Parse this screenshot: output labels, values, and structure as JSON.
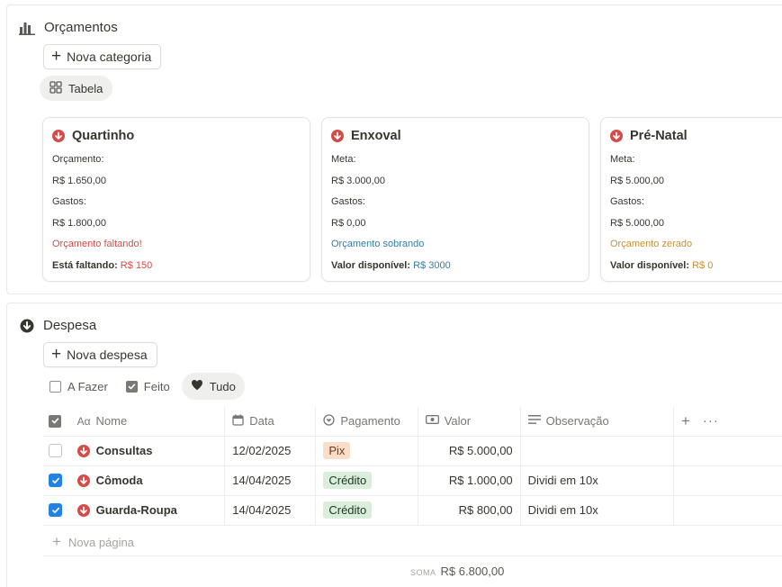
{
  "orcamentos": {
    "title": "Orçamentos",
    "new_button": "Nova categoria",
    "view_tab": "Tabela",
    "cards": [
      {
        "title": "Quartinho",
        "l1": "Orçamento:",
        "l2": "R$ 1.650,00",
        "l3": "Gastos:",
        "l4": "R$ 1.800,00",
        "status": "Orçamento faltando!",
        "foot_label": "Está faltando:",
        "foot_value": "R$ 150"
      },
      {
        "title": "Enxoval",
        "l1": "Meta:",
        "l2": "R$ 3.000,00",
        "l3": "Gastos:",
        "l4": "R$ 0,00",
        "status": "Orçamento sobrando",
        "foot_label": "Valor disponível:",
        "foot_value": "R$ 3000"
      },
      {
        "title": "Pré-Natal",
        "l1": "Meta:",
        "l2": "R$ 5.000,00",
        "l3": "Gastos:",
        "l4": "R$ 5.000,00",
        "status": "Orçamento zerado",
        "foot_label": "Valor disponível:",
        "foot_value": "R$ 0"
      }
    ],
    "status_colors": {
      "faltando": "#d44c47",
      "sobrando": "#337ea9",
      "zerado": "#cb912f"
    }
  },
  "despesa": {
    "title": "Despesa",
    "new_button": "Nova despesa",
    "filters": [
      "A Fazer",
      "Feito",
      "Tudo"
    ],
    "columns": {
      "name": "Nome",
      "date": "Data",
      "payment": "Pagamento",
      "value": "Valor",
      "note": "Observação"
    },
    "rows": [
      {
        "checked": false,
        "name": "Consultas",
        "date": "12/02/2025",
        "payment": "Pix",
        "value": "R$ 5.000,00",
        "note": ""
      },
      {
        "checked": true,
        "name": "Cômoda",
        "date": "14/04/2025",
        "payment": "Crédito",
        "value": "R$ 1.000,00",
        "note": "Dividi em 10x"
      },
      {
        "checked": true,
        "name": "Guarda-Roupa",
        "date": "14/04/2025",
        "payment": "Crédito",
        "value": "R$ 800,00",
        "note": "Dividi em 10x"
      }
    ],
    "tag_colors": {
      "Pix": "#fadec9",
      "Crédito": "#dbeddb"
    },
    "new_page": "Nova página",
    "sum_label": "SOMA",
    "sum_value": "R$ 6.800,00"
  }
}
